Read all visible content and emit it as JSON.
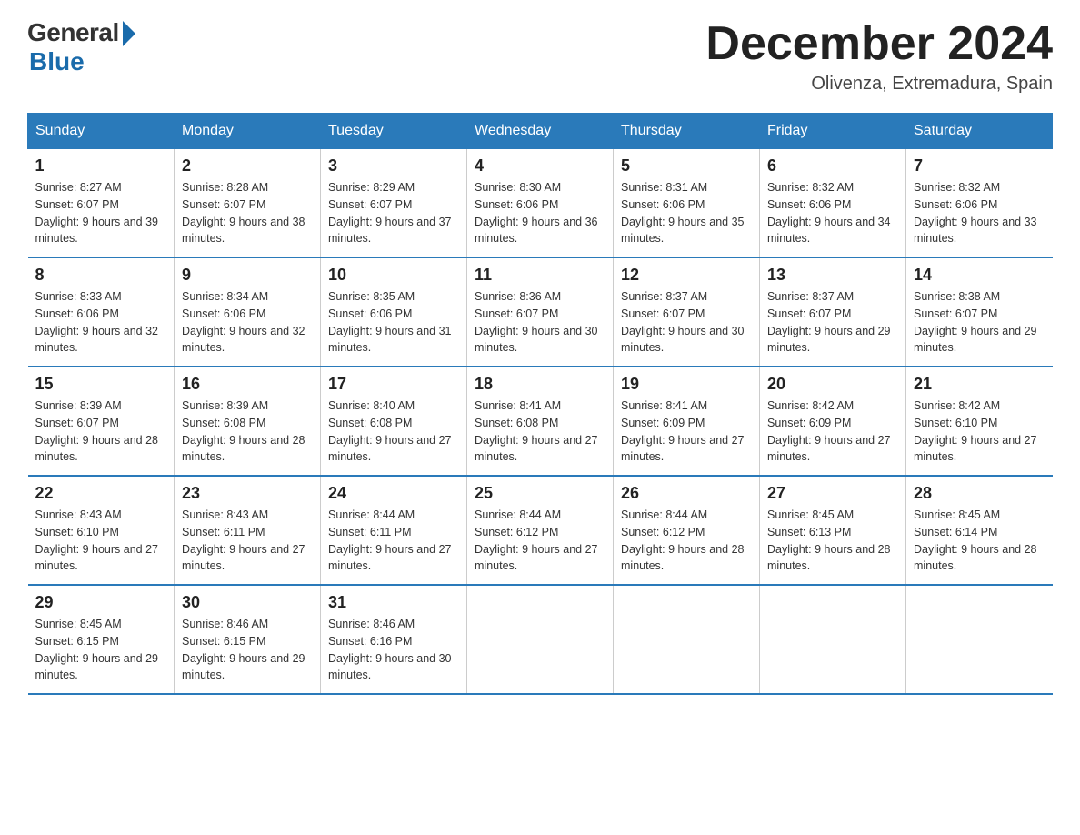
{
  "logo": {
    "general": "General",
    "blue": "Blue"
  },
  "title": "December 2024",
  "location": "Olivenza, Extremadura, Spain",
  "weekdays": [
    "Sunday",
    "Monday",
    "Tuesday",
    "Wednesday",
    "Thursday",
    "Friday",
    "Saturday"
  ],
  "weeks": [
    [
      {
        "day": "1",
        "sunrise": "8:27 AM",
        "sunset": "6:07 PM",
        "daylight": "9 hours and 39 minutes."
      },
      {
        "day": "2",
        "sunrise": "8:28 AM",
        "sunset": "6:07 PM",
        "daylight": "9 hours and 38 minutes."
      },
      {
        "day": "3",
        "sunrise": "8:29 AM",
        "sunset": "6:07 PM",
        "daylight": "9 hours and 37 minutes."
      },
      {
        "day": "4",
        "sunrise": "8:30 AM",
        "sunset": "6:06 PM",
        "daylight": "9 hours and 36 minutes."
      },
      {
        "day": "5",
        "sunrise": "8:31 AM",
        "sunset": "6:06 PM",
        "daylight": "9 hours and 35 minutes."
      },
      {
        "day": "6",
        "sunrise": "8:32 AM",
        "sunset": "6:06 PM",
        "daylight": "9 hours and 34 minutes."
      },
      {
        "day": "7",
        "sunrise": "8:32 AM",
        "sunset": "6:06 PM",
        "daylight": "9 hours and 33 minutes."
      }
    ],
    [
      {
        "day": "8",
        "sunrise": "8:33 AM",
        "sunset": "6:06 PM",
        "daylight": "9 hours and 32 minutes."
      },
      {
        "day": "9",
        "sunrise": "8:34 AM",
        "sunset": "6:06 PM",
        "daylight": "9 hours and 32 minutes."
      },
      {
        "day": "10",
        "sunrise": "8:35 AM",
        "sunset": "6:06 PM",
        "daylight": "9 hours and 31 minutes."
      },
      {
        "day": "11",
        "sunrise": "8:36 AM",
        "sunset": "6:07 PM",
        "daylight": "9 hours and 30 minutes."
      },
      {
        "day": "12",
        "sunrise": "8:37 AM",
        "sunset": "6:07 PM",
        "daylight": "9 hours and 30 minutes."
      },
      {
        "day": "13",
        "sunrise": "8:37 AM",
        "sunset": "6:07 PM",
        "daylight": "9 hours and 29 minutes."
      },
      {
        "day": "14",
        "sunrise": "8:38 AM",
        "sunset": "6:07 PM",
        "daylight": "9 hours and 29 minutes."
      }
    ],
    [
      {
        "day": "15",
        "sunrise": "8:39 AM",
        "sunset": "6:07 PM",
        "daylight": "9 hours and 28 minutes."
      },
      {
        "day": "16",
        "sunrise": "8:39 AM",
        "sunset": "6:08 PM",
        "daylight": "9 hours and 28 minutes."
      },
      {
        "day": "17",
        "sunrise": "8:40 AM",
        "sunset": "6:08 PM",
        "daylight": "9 hours and 27 minutes."
      },
      {
        "day": "18",
        "sunrise": "8:41 AM",
        "sunset": "6:08 PM",
        "daylight": "9 hours and 27 minutes."
      },
      {
        "day": "19",
        "sunrise": "8:41 AM",
        "sunset": "6:09 PM",
        "daylight": "9 hours and 27 minutes."
      },
      {
        "day": "20",
        "sunrise": "8:42 AM",
        "sunset": "6:09 PM",
        "daylight": "9 hours and 27 minutes."
      },
      {
        "day": "21",
        "sunrise": "8:42 AM",
        "sunset": "6:10 PM",
        "daylight": "9 hours and 27 minutes."
      }
    ],
    [
      {
        "day": "22",
        "sunrise": "8:43 AM",
        "sunset": "6:10 PM",
        "daylight": "9 hours and 27 minutes."
      },
      {
        "day": "23",
        "sunrise": "8:43 AM",
        "sunset": "6:11 PM",
        "daylight": "9 hours and 27 minutes."
      },
      {
        "day": "24",
        "sunrise": "8:44 AM",
        "sunset": "6:11 PM",
        "daylight": "9 hours and 27 minutes."
      },
      {
        "day": "25",
        "sunrise": "8:44 AM",
        "sunset": "6:12 PM",
        "daylight": "9 hours and 27 minutes."
      },
      {
        "day": "26",
        "sunrise": "8:44 AM",
        "sunset": "6:12 PM",
        "daylight": "9 hours and 28 minutes."
      },
      {
        "day": "27",
        "sunrise": "8:45 AM",
        "sunset": "6:13 PM",
        "daylight": "9 hours and 28 minutes."
      },
      {
        "day": "28",
        "sunrise": "8:45 AM",
        "sunset": "6:14 PM",
        "daylight": "9 hours and 28 minutes."
      }
    ],
    [
      {
        "day": "29",
        "sunrise": "8:45 AM",
        "sunset": "6:15 PM",
        "daylight": "9 hours and 29 minutes."
      },
      {
        "day": "30",
        "sunrise": "8:46 AM",
        "sunset": "6:15 PM",
        "daylight": "9 hours and 29 minutes."
      },
      {
        "day": "31",
        "sunrise": "8:46 AM",
        "sunset": "6:16 PM",
        "daylight": "9 hours and 30 minutes."
      },
      null,
      null,
      null,
      null
    ]
  ]
}
